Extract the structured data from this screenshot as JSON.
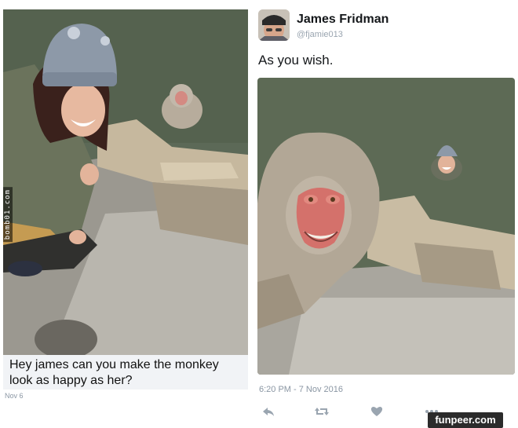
{
  "left_post": {
    "caption": "Hey james can you make the monkey look as happy as her?",
    "date": "Nov 6",
    "side_watermark": "bomb01.com"
  },
  "tweet": {
    "display_name": "James Fridman",
    "handle": "@fjamie013",
    "text": "As you wish.",
    "timestamp": "6:20 PM - 7 Nov 2016",
    "actions": [
      {
        "icon": "reply-icon"
      },
      {
        "icon": "retweet-icon"
      },
      {
        "icon": "like-icon"
      },
      {
        "icon": "more-icon"
      }
    ]
  },
  "footer": {
    "brand": "funpeer.com"
  },
  "colors": {
    "water": "#5f6c57",
    "jacket": "#6d765f",
    "hat": "#8d9aab",
    "monkey_fur": "#b5aa9a",
    "monkey_face": "#d77b72",
    "twitter_grey": "#8a96a3"
  }
}
